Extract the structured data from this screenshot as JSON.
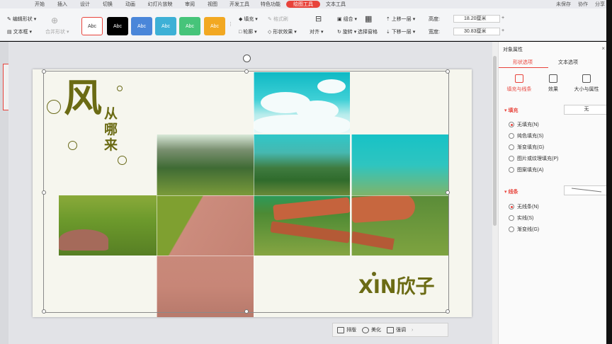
{
  "menu": {
    "items": [
      "开始",
      "插入",
      "设计",
      "切换",
      "动画",
      "幻灯片放映",
      "审阅",
      "视图",
      "开发工具",
      "特色功能",
      "绘图工具",
      "文本工具"
    ],
    "active": "绘图工具",
    "right": [
      "未保存",
      "协作",
      "分享"
    ]
  },
  "ribbon": {
    "edit_shape": "编辑形状",
    "text_box": "文本框",
    "merge_shape": "合并形状",
    "style_label": "Abc",
    "fill": "填充",
    "format_brush": "格式刷",
    "outline": "轮廓",
    "shape_effect": "形状效果",
    "align": "对齐",
    "rotate": "旋转",
    "group": "组合",
    "select_pane": "选择窗格",
    "bring_forward": "上移一层",
    "send_backward": "下移一层",
    "height_label": "高度:",
    "height_value": "18.20厘米",
    "width_label": "宽度:",
    "width_value": "30.83厘米"
  },
  "slide": {
    "title_char": "风",
    "vertical_text": [
      "从",
      "哪",
      "来"
    ],
    "brand": "XIN欣子"
  },
  "float_bar": {
    "arrange": "排版",
    "beautify": "美化",
    "animate": "强调"
  },
  "pane": {
    "title": "对象属性",
    "tab_shape": "形状选项",
    "tab_text": "文本选项",
    "sub_fill_line": "填充与线条",
    "sub_effect": "效果",
    "sub_size": "大小与属性",
    "fill_head": "填充",
    "fill_value": "无",
    "fill_options": [
      "无填充(N)",
      "纯色填充(S)",
      "渐变填充(G)",
      "图片或纹理填充(P)",
      "图案填充(A)"
    ],
    "fill_selected": 0,
    "line_head": "线条",
    "line_options": [
      "无线条(N)",
      "实线(S)",
      "渐变线(G)"
    ],
    "line_selected": 0
  },
  "colors": {
    "accent": "#e8433b",
    "title_olive": "#6b6b14"
  }
}
